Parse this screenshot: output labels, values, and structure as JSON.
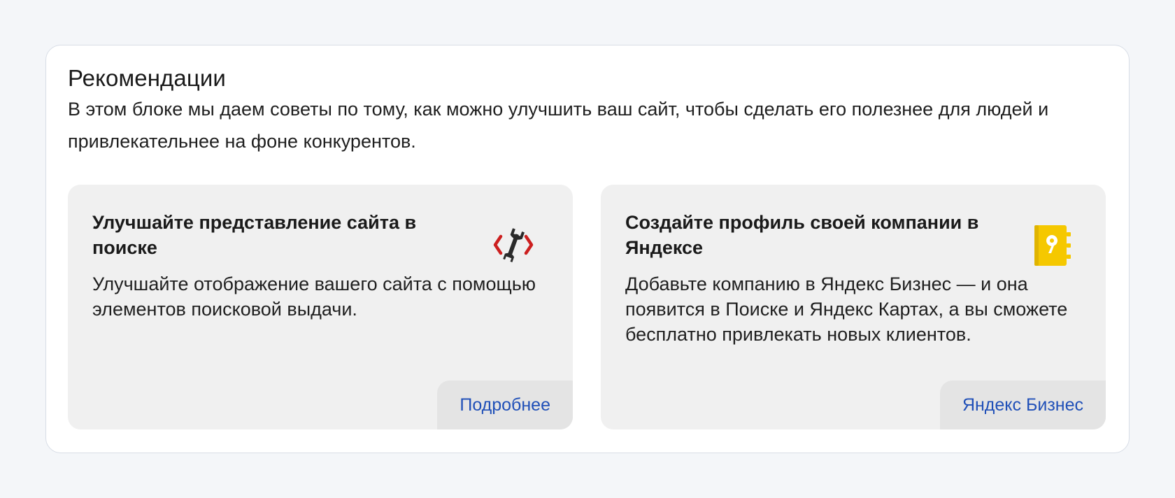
{
  "recommendations": {
    "title": "Рекомендации",
    "description": "В этом блоке мы даем советы по тому, как можно улучшить ваш сайт, чтобы сделать его полезнее для людей и привлекательнее на фоне конкурентов.",
    "cards": [
      {
        "title": "Улучшайте представление сайта в поиске",
        "text": "Улучшайте отображение вашего сайта с помощью элементов поисковой выдачи.",
        "icon": "wrench-code-icon",
        "link_label": "Подробнее"
      },
      {
        "title": "Создайте профиль своей компании в Яндексе",
        "text": "Добавьте компанию в Яндекс Бизнес — и она появится в Поиске и Яндекс Картах, а вы сможете бесплатно привлекать новых клиентов.",
        "icon": "yandex-business-icon",
        "link_label": "Яндекс Бизнес"
      }
    ]
  },
  "colors": {
    "page_bg": "#f4f6f9",
    "card_bg": "#f0f0f0",
    "link": "#2050b8",
    "icon_red": "#cc1f1f",
    "icon_yellow": "#f5c800"
  }
}
